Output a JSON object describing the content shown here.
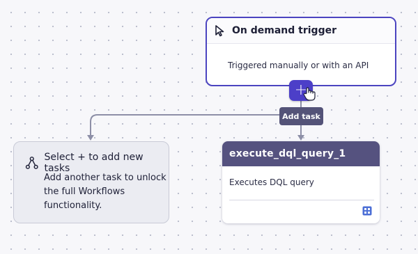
{
  "trigger": {
    "title": "On demand trigger",
    "description": "Triggered manually or with an API",
    "icon": "cursor-arrow-icon"
  },
  "add_button": {
    "label": "+",
    "tooltip": "Add task"
  },
  "hint_card": {
    "title": "Select + to add new tasks",
    "body": "Add another task to unlock the full Workflows functionality.",
    "icon": "branch-icon"
  },
  "task": {
    "name": "execute_dql_query_1",
    "description": "Executes DQL query",
    "action_icon": "workflow-grid-icon"
  },
  "colors": {
    "accent": "#4c3fc8",
    "task_header": "#55527f",
    "tooltip": "#545378",
    "connector": "#8d8fa7"
  }
}
